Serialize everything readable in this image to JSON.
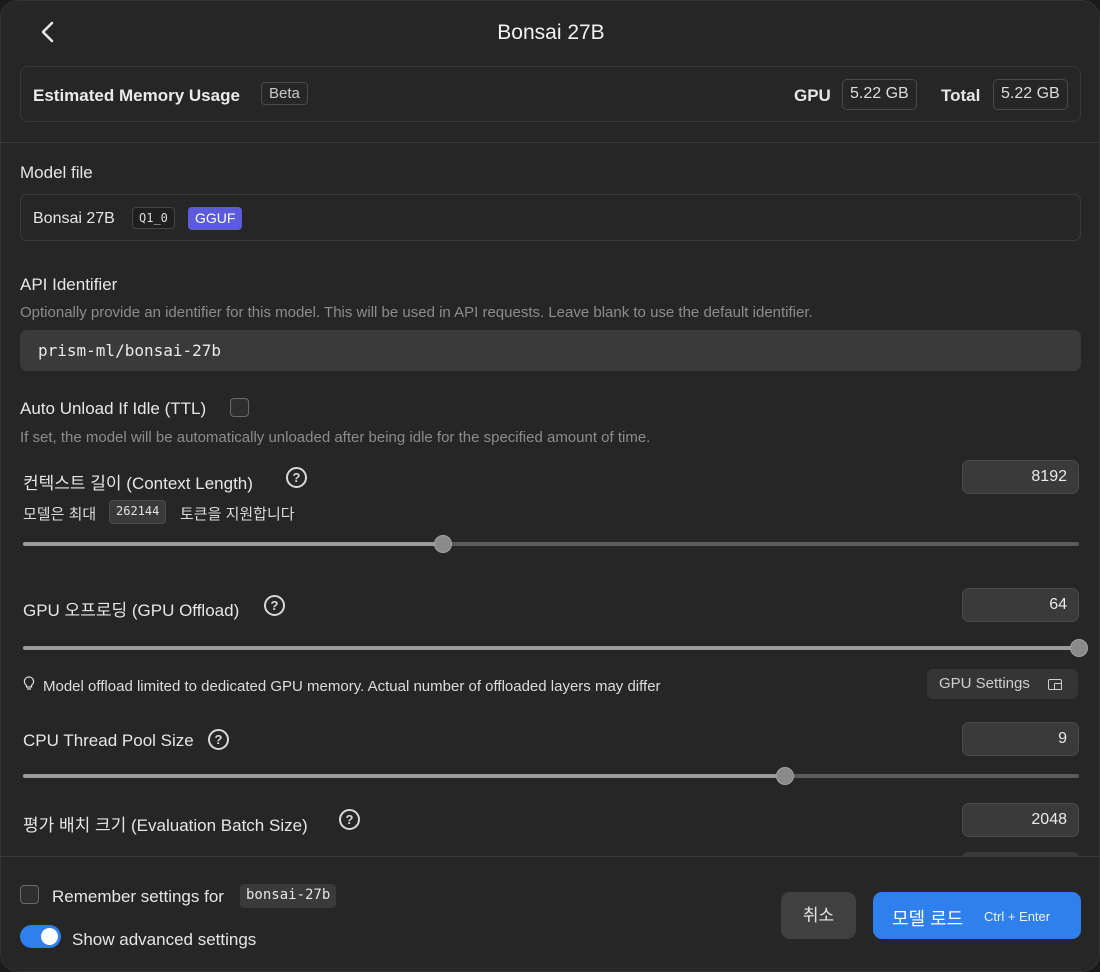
{
  "header": {
    "title": "Bonsai 27B"
  },
  "memory": {
    "label": "Estimated Memory Usage",
    "beta": "Beta",
    "gpu_label": "GPU",
    "gpu_value": "5.22 GB",
    "total_label": "Total",
    "total_value": "5.22 GB"
  },
  "model_file": {
    "label": "Model file",
    "name": "Bonsai 27B",
    "quant": "Q1_0",
    "format": "GGUF"
  },
  "api": {
    "label": "API Identifier",
    "description": "Optionally provide an identifier for this model. This will be used in API requests. Leave blank to use the default identifier.",
    "value": "prism-ml/bonsai-27b"
  },
  "ttl": {
    "label": "Auto Unload If Idle (TTL)",
    "checked": false,
    "description": "If set, the model will be automatically unloaded after being idle for the specified amount of time."
  },
  "context": {
    "label": "컨텍스트 길이 (Context Length)",
    "value": "8192",
    "support_prefix": "모델은 최대",
    "max_tokens": "262144",
    "support_suffix": "토큰을 지원합니다",
    "slider_fraction": 0.398
  },
  "gpu_offload": {
    "label": "GPU 오프로딩 (GPU Offload)",
    "value": "64",
    "slider_fraction": 1.0,
    "note": "Model offload limited to dedicated GPU memory. Actual number of offloaded layers may differ",
    "settings_button": "GPU Settings"
  },
  "cpu_threads": {
    "label": "CPU Thread Pool Size",
    "value": "9",
    "slider_fraction": 0.722
  },
  "batch": {
    "label": "평가 배치 크기 (Evaluation Batch Size)",
    "value": "2048"
  },
  "footer": {
    "remember_label": "Remember settings for",
    "remember_model": "bonsai-27b",
    "advanced_label": "Show advanced settings",
    "advanced_on": true,
    "cancel": "취소",
    "load": "모델 로드",
    "load_shortcut": "Ctrl + Enter"
  },
  "colors": {
    "accent": "#2f80ed",
    "gguf_badge": "#5b5bdc"
  }
}
